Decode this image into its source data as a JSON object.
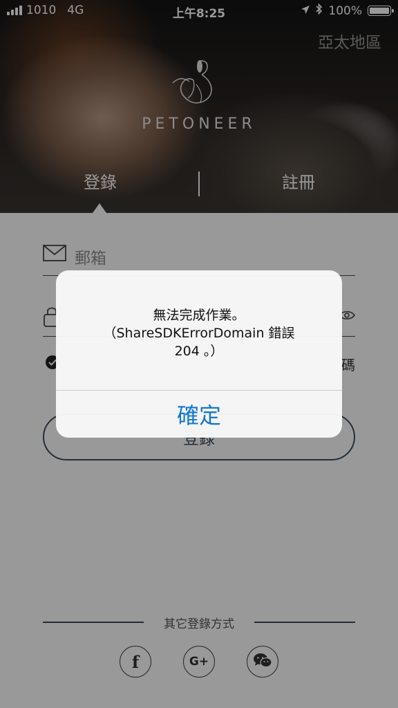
{
  "status_bar": {
    "carrier": "1010",
    "network": "4G",
    "time": "上午8:25",
    "battery": "100%"
  },
  "hero": {
    "region": "亞太地區",
    "brand": "PETONEER",
    "tabs": {
      "login": "登錄",
      "register": "註冊"
    }
  },
  "form": {
    "email_placeholder": "郵箱",
    "password_placeholder": "",
    "remember_label": "",
    "forgot_label": "碼",
    "login_button": "登錄",
    "other_login": "其它登錄方式"
  },
  "social": {
    "facebook_glyph": "f",
    "google_plus_glyph": "G+"
  },
  "alert": {
    "message": "無法完成作業。\n（ShareSDKErrorDomain 錯誤\n204 。）",
    "confirm": "確定"
  },
  "colors": {
    "accent_blue": "#1478d4",
    "line": "#3c4b5a"
  }
}
